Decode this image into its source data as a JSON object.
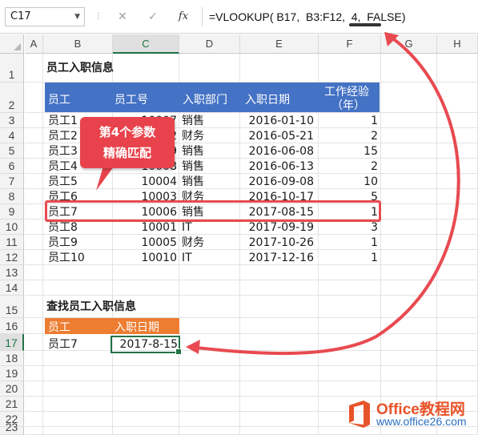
{
  "formula_bar": {
    "name_box": "C17",
    "cancel_symbol": "✕",
    "confirm_symbol": "✓",
    "fx_label": "fx",
    "formula": "=VLOOKUP( B17,  B3:F12,  4,  FALSE)"
  },
  "columns": [
    "A",
    "B",
    "C",
    "D",
    "E",
    "F",
    "G",
    "H"
  ],
  "rows": [
    "1",
    "2",
    "3",
    "4",
    "5",
    "6",
    "7",
    "8",
    "9",
    "10",
    "11",
    "12",
    "13",
    "14",
    "15",
    "16",
    "17",
    "18",
    "19",
    "20",
    "21",
    "22",
    "23"
  ],
  "table1": {
    "title": "员工入职信息",
    "headers": [
      "员工",
      "员工号",
      "入职部门",
      "入职日期",
      "工作经验",
      "（年）"
    ],
    "rows": [
      {
        "name": "员工1",
        "id": "10007",
        "dept": "销售",
        "date": "2016-01-10",
        "exp": "1"
      },
      {
        "name": "员工2",
        "id": "10002",
        "dept": "财务",
        "date": "2016-05-21",
        "exp": "2"
      },
      {
        "name": "员工3",
        "id": "10009",
        "dept": "销售",
        "date": "2016-06-08",
        "exp": "15"
      },
      {
        "name": "员工4",
        "id": "10008",
        "dept": "销售",
        "date": "2016-06-13",
        "exp": "2"
      },
      {
        "name": "员工5",
        "id": "10004",
        "dept": "销售",
        "date": "2016-09-08",
        "exp": "10"
      },
      {
        "name": "员工6",
        "id": "10003",
        "dept": "财务",
        "date": "2016-10-17",
        "exp": "5"
      },
      {
        "name": "员工7",
        "id": "10006",
        "dept": "销售",
        "date": "2017-08-15",
        "exp": "1"
      },
      {
        "name": "员工8",
        "id": "10001",
        "dept": "IT",
        "date": "2017-09-19",
        "exp": "3"
      },
      {
        "name": "员工9",
        "id": "10005",
        "dept": "财务",
        "date": "2017-10-26",
        "exp": "1"
      },
      {
        "name": "员工10",
        "id": "10010",
        "dept": "IT",
        "date": "2017-12-16",
        "exp": "1"
      }
    ]
  },
  "table2": {
    "title": "查找员工入职信息",
    "headers": [
      "员工",
      "入职日期"
    ],
    "name": "员工7",
    "date": "2017-8-15"
  },
  "callout": {
    "line1": "第4个参数",
    "line2": "精确匹配"
  },
  "logo": {
    "brand": "Office教程网",
    "url": "www.office26.com"
  },
  "colors": {
    "table_header": "#4472c4",
    "lookup_header": "#ed7d31",
    "highlight": "#e84a50",
    "selection": "#217346"
  }
}
